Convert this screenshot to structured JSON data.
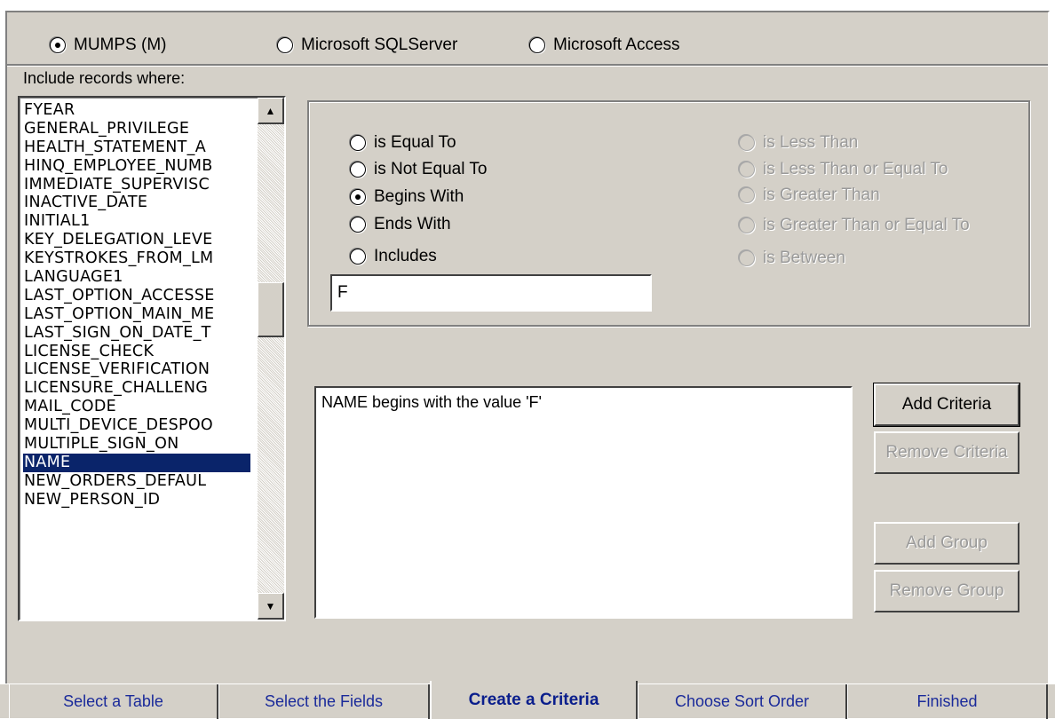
{
  "db_options": [
    {
      "label": "MUMPS (M)",
      "checked": true
    },
    {
      "label": "Microsoft SQLServer",
      "checked": false
    },
    {
      "label": "Microsoft Access",
      "checked": false
    }
  ],
  "include_label": "Include records where:",
  "fields": [
    "FYEAR",
    "GENERAL_PRIVILEGE",
    "HEALTH_STATEMENT_A",
    "HINQ_EMPLOYEE_NUMB",
    "IMMEDIATE_SUPERVISC",
    "INACTIVE_DATE",
    "INITIAL1",
    "KEY_DELEGATION_LEVE",
    "KEYSTROKES_FROM_LM",
    "LANGUAGE1",
    "LAST_OPTION_ACCESSE",
    "LAST_OPTION_MAIN_ME",
    "LAST_SIGN_ON_DATE_T",
    "LICENSE_CHECK",
    "LICENSE_VERIFICATION",
    "LICENSURE_CHALLENG",
    "MAIL_CODE",
    "MULTI_DEVICE_DESPOO",
    "MULTIPLE_SIGN_ON",
    "NAME",
    "NEW_ORDERS_DEFAUL",
    "NEW_PERSON_ID"
  ],
  "selected_field": "NAME",
  "operators_left": [
    {
      "label": "is Equal To",
      "checked": false
    },
    {
      "label": "is Not Equal To",
      "checked": false
    },
    {
      "label": "Begins With",
      "checked": true
    },
    {
      "label": "Ends With",
      "checked": false
    },
    {
      "label": "Includes",
      "checked": false
    }
  ],
  "operators_right": [
    {
      "label": "is Less Than",
      "enabled": false
    },
    {
      "label": "is Less Than or Equal To",
      "enabled": false
    },
    {
      "label": "is Greater Than",
      "enabled": false
    },
    {
      "label": "is Greater Than or Equal To",
      "enabled": false
    },
    {
      "label": "is Between",
      "enabled": false
    }
  ],
  "value_input": "F",
  "criteria_text": "NAME begins with the value 'F'",
  "buttons": {
    "add_criteria": "Add Criteria",
    "remove_criteria": "Remove Criteria",
    "add_group": "Add Group",
    "remove_group": "Remove Group"
  },
  "tabs": [
    {
      "label": "Select a Table",
      "active": false
    },
    {
      "label": "Select the Fields",
      "active": false
    },
    {
      "label": "Create a Criteria",
      "active": true
    },
    {
      "label": "Choose Sort Order",
      "active": false
    },
    {
      "label": "Finished",
      "active": false
    }
  ]
}
